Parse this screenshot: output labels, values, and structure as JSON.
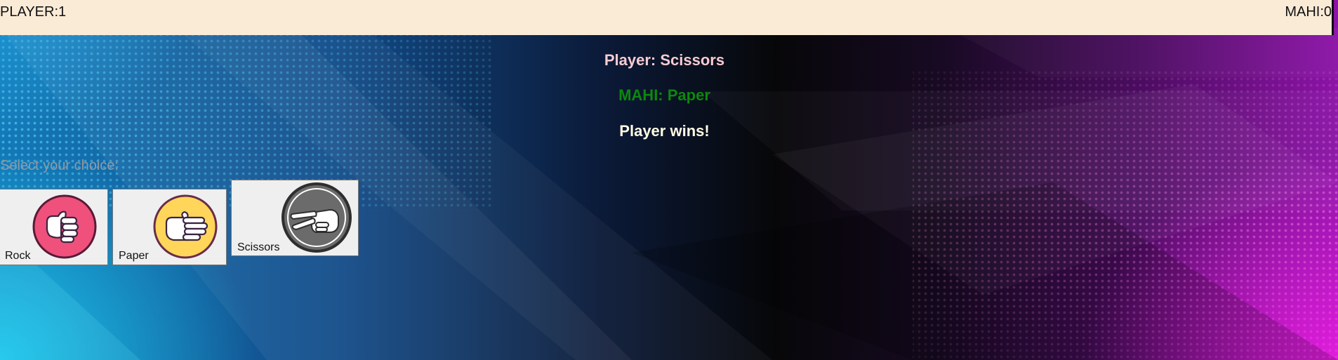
{
  "scoreboard": {
    "player_score_text": "PLAYER:1",
    "ai_score_text": "MAHI:0"
  },
  "result": {
    "player_choice_text": "Player: Scissors",
    "ai_choice_text": "MAHI: Paper",
    "outcome_text": "Player wins!"
  },
  "prompt_text": "Select your choice:",
  "choices": [
    {
      "label": "Rock",
      "icon": "fist-icon",
      "color": "#f0507c"
    },
    {
      "label": "Paper",
      "icon": "open-hand-icon",
      "color": "#ffd65a"
    },
    {
      "label": "Scissors",
      "icon": "peace-sign-icon",
      "color": "#6b6b6b"
    }
  ],
  "colors": {
    "score_bar": "#faebd7",
    "player_line": "#f7cbd1",
    "ai_line": "#0d870d",
    "outcome_line": "#fffbe4",
    "prompt": "#8e9aa8"
  }
}
